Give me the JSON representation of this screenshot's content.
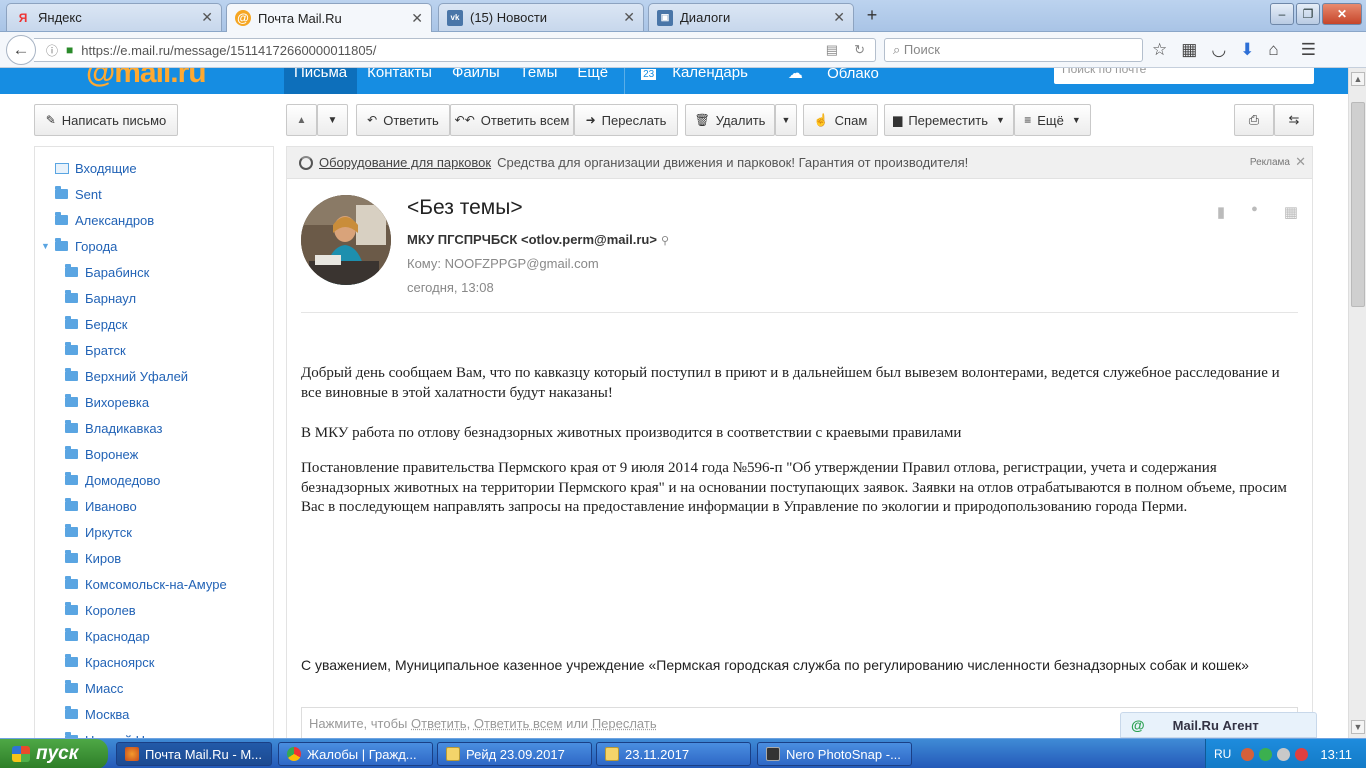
{
  "browser": {
    "tabs": [
      {
        "title": "Яндекс",
        "icon": "yandex-icon",
        "fav": "Я",
        "active": false
      },
      {
        "title": "Почта Mail.Ru",
        "icon": "mailru-icon",
        "fav": "@",
        "active": true
      },
      {
        "title": "(15) Новости",
        "icon": "vk-icon",
        "fav": "vk",
        "active": false
      },
      {
        "title": "Диалоги",
        "icon": "dialogs-icon",
        "fav": "▣",
        "active": false
      }
    ],
    "url": "https://e.mail.ru/message/15114172660000011805/",
    "search_placeholder": "Поиск"
  },
  "mail": {
    "logo": "@mail.ru",
    "nav": [
      "Письма",
      "Контакты",
      "Файлы",
      "Темы",
      "Ещё"
    ],
    "calendar": "Календарь",
    "calendar_badge": "23",
    "cloud": "Облако",
    "search_placeholder": "Поиск по почте"
  },
  "toolbar": {
    "compose": "Написать письмо",
    "reply": "Ответить",
    "reply_all": "Ответить всем",
    "forward": "Переслать",
    "delete": "Удалить",
    "spam": "Спам",
    "move": "Переместить",
    "more": "Ещё"
  },
  "sidebar": {
    "inbox": "Входящие",
    "folders": [
      "Sent",
      "Александров",
      "Города"
    ],
    "subfolders": [
      "Барабинск",
      "Барнаул",
      "Бердск",
      "Братск",
      "Верхний Уфалей",
      "Вихоревка",
      "Владикавказ",
      "Воронеж",
      "Домодедово",
      "Иваново",
      "Иркутск",
      "Киров",
      "Комсомольск-на-Амуре",
      "Королев",
      "Краснодар",
      "Красноярск",
      "Миасс",
      "Москва",
      "Нижний Новгород"
    ]
  },
  "ad": {
    "link": "Оборудование для парковок",
    "text": "Средства для организации движения и парковок! Гарантия от производителя!",
    "label": "Реклама"
  },
  "message": {
    "subject": "<Без темы>",
    "from": "МКУ ПГСПРЧБСК <otlov.perm@mail.ru>",
    "to": "Кому: NOOFZPPGP@gmail.com",
    "date": "сегодня, 13:08",
    "p1": "Добрый день сообщаем Вам, что по кавказцу который поступил в приют и в дальнейшем был вывезем волонтерами, ведется служебное расследование и все виновные в этой халатности будут наказаны!",
    "p2": "В МКУ работа по отлову безнадзорных животных производится в соответствии с краевыми правилами",
    "p3": "Постановление правительства Пермского края от 9 июля 2014 года №596-п \"Об утверждении Правил отлова, регистрации, учета и содержания безнадзорных животных на территории Пермского края\" и на основании поступающих заявок. Заявки на отлов отрабатываются в полном объеме, просим Вас в последующем направлять запросы на предоставление информации в Управление по экологии и природопользованию города Перми.",
    "signature": "С уважением, Муниципальное казенное учреждение «Пермская городская служба по регулированию численности безнадзорных собак и кошек»"
  },
  "reply_bar": {
    "prefix": "Нажмите, чтобы",
    "reply": "Ответить",
    "comma": ",",
    "reply_all": "Ответить всем",
    "or": "или",
    "forward": "Переслать"
  },
  "agent": {
    "label": "Mail.Ru Агент"
  },
  "taskbar": {
    "start": "пуск",
    "tasks": [
      {
        "title": "Почта Mail.Ru - M...",
        "active": true
      },
      {
        "title": "Жалобы | Гражд..."
      },
      {
        "title": "Рейд 23.09.2017"
      },
      {
        "title": "23.11.2017"
      },
      {
        "title": "Nero PhotoSnap -..."
      }
    ],
    "lang": "RU",
    "clock": "13:11"
  },
  "colors": {
    "mail_blue": "#168de2",
    "link_blue": "#2263b6",
    "folder_blue": "#5aa5e2",
    "logo_orange": "#ffa930"
  }
}
